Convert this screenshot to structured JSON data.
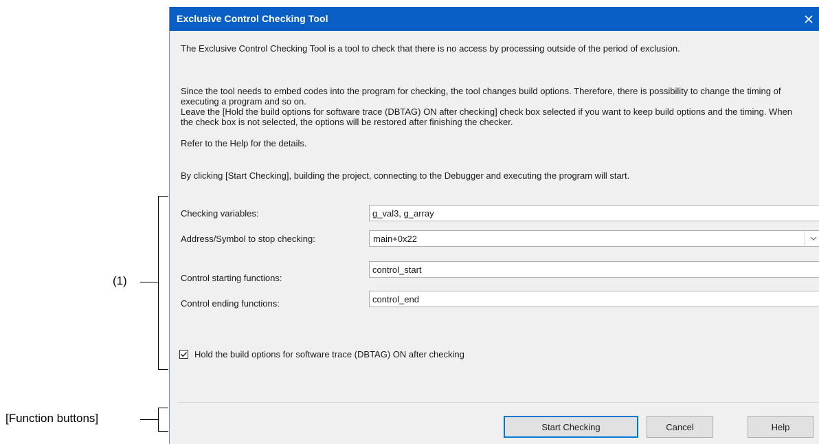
{
  "annotations": {
    "group_label": "(1)",
    "buttons_label": "[Function buttons]"
  },
  "dialog": {
    "title": "Exclusive Control Checking Tool",
    "close_icon": "close-icon",
    "description": [
      "The Exclusive Control Checking Tool is a tool to check that there is no access by processing outside of the period of exclusion.",
      "Since the tool needs to embed codes into the program for checking, the tool changes build options. Therefore, there is possibility to change the timing of executing a program and so on.",
      "Leave the [Hold the build options for software trace (DBTAG) ON after checking] check box selected if you want to keep build options and the timing. When the check box is not selected, the options will be restored after finishing the checker.",
      "Refer to the Help for the details.",
      "By clicking [Start Checking], building the project, connecting to the Debugger and executing the program will start."
    ],
    "fields": {
      "checking_variables": {
        "label": "Checking variables:",
        "value": "g_val3, g_array"
      },
      "stop_address": {
        "label": "Address/Symbol to stop checking:",
        "value": "main+0x22"
      },
      "start_functions": {
        "label": "Control starting functions:",
        "value": "control_start"
      },
      "end_functions": {
        "label": "Control ending functions:",
        "value": "control_end"
      }
    },
    "hold_option": {
      "label": "Hold the build options for software trace (DBTAG) ON after checking",
      "checked": true
    },
    "buttons": {
      "start": "Start Checking",
      "cancel": "Cancel",
      "help": "Help"
    }
  },
  "colors": {
    "titlebar": "#0a5fc7",
    "dialog_bg": "#f0f0f0",
    "default_button_border": "#0078d7"
  }
}
